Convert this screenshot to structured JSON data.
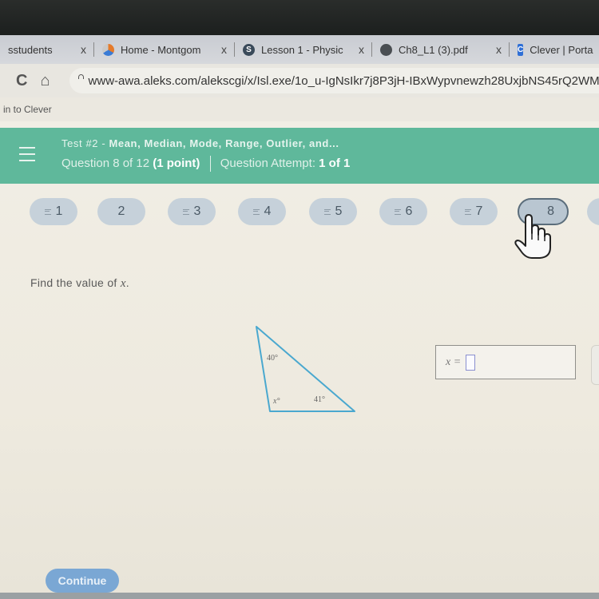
{
  "browser": {
    "tabs": [
      {
        "label": "sstudents",
        "icon": "none",
        "close": "x"
      },
      {
        "label": "Home - Montgom",
        "icon": "globe-icon",
        "close": "x"
      },
      {
        "label": "Lesson 1 - Physic",
        "icon": "schoology-icon",
        "close": "x"
      },
      {
        "label": "Ch8_L1 (3).pdf",
        "icon": "globe-icon",
        "close": "x"
      },
      {
        "label": "Clever | Porta",
        "icon": "clever-icon",
        "icon_text": "C",
        "close": ""
      }
    ],
    "url": "www-awa.aleks.com/alekscgi/x/Isl.exe/1o_u-IgNsIkr7j8P3jH-IBxWypvnewzh28UxjbNS45rQ2WM",
    "bookmark_label": "in to Clever",
    "reload_glyph": "C",
    "home_glyph": "⌂"
  },
  "header": {
    "title_prefix": "Test #2 - ",
    "title": "Mean, Median, Mode, Range, Outlier, and...",
    "question_text": "Question 8 of 12",
    "points": "(1 point)",
    "attempt_label": "Question Attempt:",
    "attempt_value": "1 of 1",
    "accent_color": "#5fb89b"
  },
  "question_nav": {
    "items": [
      {
        "label": "1",
        "answered": true
      },
      {
        "label": "2",
        "answered": false
      },
      {
        "label": "3",
        "answered": true
      },
      {
        "label": "4",
        "answered": true
      },
      {
        "label": "5",
        "answered": true
      },
      {
        "label": "6",
        "answered": true
      },
      {
        "label": "7",
        "answered": true
      },
      {
        "label": "8",
        "answered": false,
        "current": true
      }
    ]
  },
  "problem": {
    "prompt": "Find the value of ",
    "variable": "x",
    "prompt_end": ".",
    "figure": {
      "shape": "triangle",
      "angle_top": "40°",
      "angle_bottom_left": "x°",
      "angle_bottom_right": "41°",
      "stroke_color": "#4aa8cf"
    },
    "answer": {
      "label": "x =",
      "value": ""
    }
  },
  "footer": {
    "continue_label": "Continue"
  }
}
